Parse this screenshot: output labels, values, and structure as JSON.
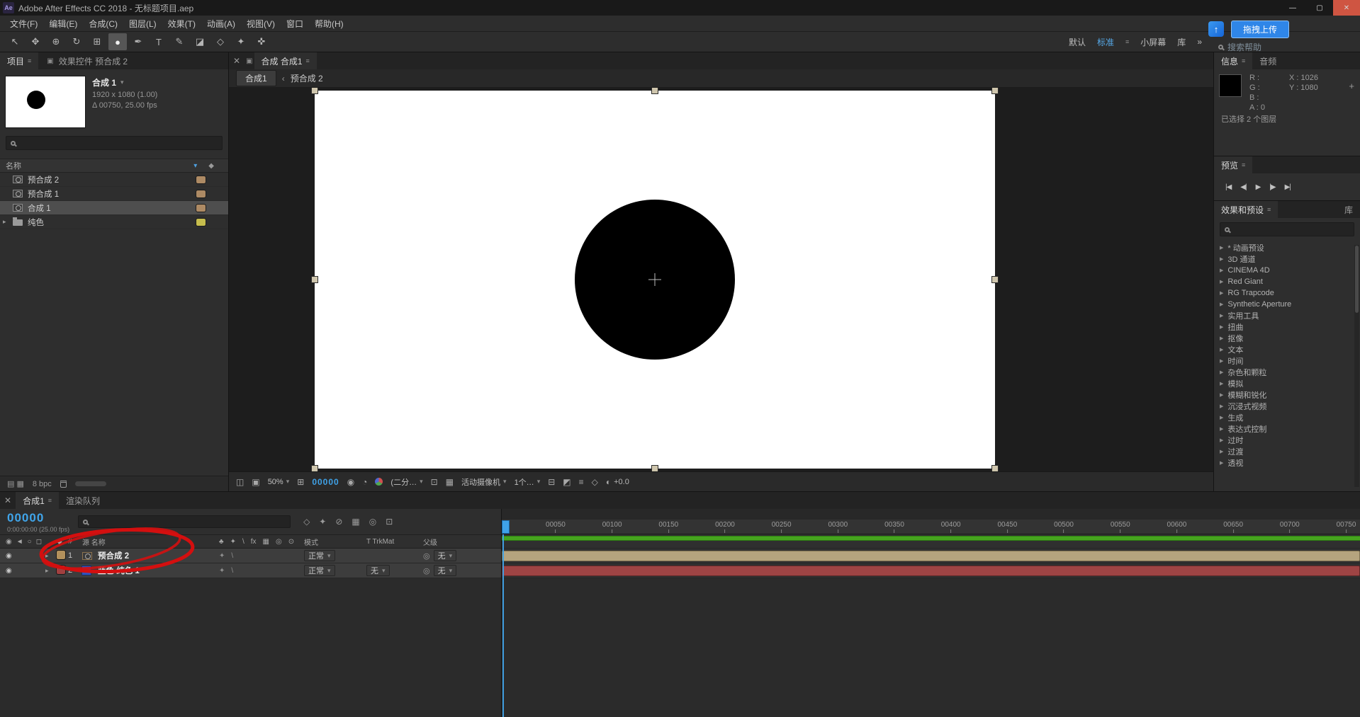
{
  "colors": {
    "accent_blue": "#3fa2e8",
    "annotation_red": "#d40f0f",
    "green_bar": "#46a41e"
  },
  "icons": {
    "menu": "≡",
    "dropdown": "▾",
    "expander": "▸",
    "close": "✕",
    "chevron_left": "‹",
    "diamond": "◆",
    "eye": "◉",
    "pickwhip": "◎",
    "tri_right": "▶",
    "plus": "+",
    "panel": "▣"
  },
  "title_bar": {
    "app_icon": "Ae",
    "title": "Adobe After Effects CC 2018 - 无标题项目.aep",
    "minimize": "—",
    "maximize": "▢",
    "close": "✕"
  },
  "menu_bar": [
    "文件(F)",
    "编辑(E)",
    "合成(C)",
    "图层(L)",
    "效果(T)",
    "动画(A)",
    "视图(V)",
    "窗口",
    "帮助(H)"
  ],
  "toolbar": {
    "tools": [
      {
        "name": "selection-tool",
        "glyph": "↖",
        "active": false
      },
      {
        "name": "hand-tool",
        "glyph": "✥",
        "active": false
      },
      {
        "name": "zoom-tool",
        "glyph": "⊕",
        "active": false
      },
      {
        "name": "orbit-camera-tool",
        "glyph": "↻",
        "active": false
      },
      {
        "name": "pan-behind-tool",
        "glyph": "⊞",
        "active": false
      },
      {
        "name": "shape-tool",
        "glyph": "●",
        "active": true
      },
      {
        "name": "pen-tool",
        "glyph": "✒",
        "active": false
      },
      {
        "name": "text-tool",
        "glyph": "T",
        "active": false
      },
      {
        "name": "brush-tool",
        "glyph": "✎",
        "active": false
      },
      {
        "name": "clone-stamp-tool",
        "glyph": "◪",
        "active": false
      },
      {
        "name": "eraser-tool",
        "glyph": "◇",
        "active": false
      },
      {
        "name": "roto-brush-tool",
        "glyph": "✦",
        "active": false
      },
      {
        "name": "puppet-pin-tool",
        "glyph": "✜",
        "active": false
      }
    ],
    "workspaces": [
      {
        "name": "workspace-default",
        "label": "默认",
        "active": false
      },
      {
        "name": "workspace-standard",
        "label": "标准",
        "active": true
      },
      {
        "name": "workspace-small-screen",
        "label": "小屏幕",
        "active": false
      },
      {
        "name": "workspace-library",
        "label": "库",
        "active": false
      },
      {
        "name": "workspace-overflow",
        "label": "»",
        "active": false
      }
    ]
  },
  "overlay": {
    "icon_glyph": "↑",
    "upload_button": "拖拽上传",
    "search_help": "搜索帮助"
  },
  "project_panel": {
    "tab_project": "项目",
    "tab_effect_controls": "效果控件 预合成 2",
    "comp_name": "合成 1",
    "comp_dims": "1920 x 1080 (1.00)",
    "comp_duration": "Δ 00750, 25.00 fps",
    "header_name": "名称",
    "items": [
      {
        "name": "预合成 2",
        "type": "comp",
        "label_color": "#ad8a64",
        "selected": false
      },
      {
        "name": "预合成 1",
        "type": "comp",
        "label_color": "#ad8a64",
        "selected": false
      },
      {
        "name": "合成 1",
        "type": "comp",
        "label_color": "#ad8a64",
        "selected": true
      },
      {
        "name": "纯色",
        "type": "folder",
        "label_color": "#c6bd4d",
        "selected": false
      }
    ],
    "footer_icons": [
      {
        "name": "project-settings-icon",
        "glyph": "▤"
      },
      {
        "name": "new-folder-icon",
        "glyph": "▦"
      }
    ],
    "bit_depth": "8 bpc"
  },
  "comp_panel": {
    "tab_label": "合成 合成1",
    "nav_comp": "合成1",
    "nav_current": "预合成 2",
    "controls": [
      {
        "kind": "icon",
        "name": "snapshot-icon",
        "glyph": "◫"
      },
      {
        "kind": "icon",
        "name": "show-snapshot-icon",
        "glyph": "▣"
      },
      {
        "kind": "dropdown",
        "name": "magnification-select",
        "label": "50%"
      },
      {
        "kind": "icon",
        "name": "grid-guides-icon",
        "glyph": "⊞"
      },
      {
        "kind": "blue",
        "name": "viewer-timecode",
        "label": "00000"
      },
      {
        "kind": "icon",
        "name": "camera-icon",
        "glyph": "◉"
      },
      {
        "kind": "icon",
        "name": "mask-visibility-icon",
        "glyph": "◔"
      },
      {
        "kind": "rgb",
        "name": "channel-icon"
      },
      {
        "kind": "dropdown",
        "name": "resolution-select",
        "label": "(二分…"
      },
      {
        "kind": "icon",
        "name": "roi-icon",
        "glyph": "⊡"
      },
      {
        "kind": "icon",
        "name": "transparency-grid-icon",
        "glyph": "▦"
      },
      {
        "kind": "dropdown",
        "name": "camera-view-select",
        "label": "活动摄像机"
      },
      {
        "kind": "dropdown",
        "name": "view-layout-select",
        "label": "1个…"
      },
      {
        "kind": "icon",
        "name": "pixel-aspect-icon",
        "glyph": "⊟"
      },
      {
        "kind": "icon",
        "name": "fast-preview-icon",
        "glyph": "◩"
      },
      {
        "kind": "icon",
        "name": "timeline-button-icon",
        "glyph": "≡"
      },
      {
        "kind": "icon",
        "name": "flowchart-button-icon",
        "glyph": "◇"
      },
      {
        "kind": "exposure",
        "name": "exposure-control",
        "glyph": "◐",
        "label": "+0.0"
      }
    ]
  },
  "info_panel": {
    "tab_info": "信息",
    "tab_audio": "音频",
    "rgba_lines": [
      "R :",
      "G :",
      "B :",
      "A :  0"
    ],
    "x": "X : 1026",
    "y": "Y : 1080",
    "plus": "+",
    "selection": "已选择 2 个图层"
  },
  "preview_panel": {
    "title": "预览",
    "buttons": [
      {
        "name": "first-frame-button",
        "glyph": "|◀"
      },
      {
        "name": "prev-frame-button",
        "glyph": "◀|"
      },
      {
        "name": "play-button",
        "glyph": "▶"
      },
      {
        "name": "next-frame-button",
        "glyph": "|▶"
      },
      {
        "name": "last-frame-button",
        "glyph": "▶|"
      }
    ]
  },
  "effects_panel": {
    "title": "效果和预设",
    "library_tab": "库",
    "categories": [
      "* 动画预设",
      "3D 通道",
      "CINEMA 4D",
      "Red Giant",
      "RG Trapcode",
      "Synthetic Aperture",
      "实用工具",
      "扭曲",
      "抠像",
      "文本",
      "时间",
      "杂色和颗粒",
      "模拟",
      "模糊和锐化",
      "沉浸式视频",
      "生成",
      "表达式控制",
      "过时",
      "过渡",
      "透视"
    ]
  },
  "timeline": {
    "tab_comp": "合成1",
    "tab_render_queue": "渲染队列",
    "timecode": "00000",
    "timecode_detail": "0:00:00:00 (25.00 fps)",
    "col_number": "#",
    "col_source_name": "源 名称",
    "col_mode": "模式",
    "col_trkmat": "T TrkMat",
    "col_parent": "父级",
    "toggle_icons": [
      {
        "name": "composition-mini-flowchart-icon",
        "glyph": "◇"
      },
      {
        "name": "draft-3d-icon",
        "glyph": "✦"
      },
      {
        "name": "hide-shy-layers-icon",
        "glyph": "⊘"
      },
      {
        "name": "frame-blending-icon",
        "glyph": "▦"
      },
      {
        "name": "motion-blur-icon",
        "glyph": "◎"
      },
      {
        "name": "graph-editor-icon",
        "glyph": "⊡"
      }
    ],
    "av_header_icons": [
      {
        "name": "video-column-icon",
        "glyph": "◉"
      },
      {
        "name": "audio-column-icon",
        "glyph": "◄"
      },
      {
        "name": "solo-column-icon",
        "glyph": "○"
      },
      {
        "name": "lock-column-icon",
        "glyph": "◻"
      }
    ],
    "switch_header_icons": [
      {
        "name": "shy-column-icon",
        "glyph": "♣"
      },
      {
        "name": "collapse-column-icon",
        "glyph": "✦"
      },
      {
        "name": "quality-column-icon",
        "glyph": "\\"
      },
      {
        "name": "fx-column-icon",
        "glyph": "fx"
      },
      {
        "name": "frame-blend-column-icon",
        "glyph": "▦"
      },
      {
        "name": "motion-blur-column-icon",
        "glyph": "◎"
      },
      {
        "name": "threed-column-icon",
        "glyph": "⊙"
      }
    ],
    "row_switch_glyphs": [
      "✦",
      "\\"
    ],
    "layers": [
      {
        "num": "1",
        "name": "预合成 2",
        "type": "comp",
        "mode": "正常",
        "trkmat": "",
        "parent": "无",
        "selected": true,
        "chip": "#b3915c",
        "icon_color": "#8d7350",
        "bar": "#b5a47e",
        "bar_border": "#7e7050"
      },
      {
        "num": "2",
        "name": "蓝色 纯色 1",
        "type": "solid",
        "mode": "正常",
        "trkmat": "无",
        "parent": "无",
        "selected": true,
        "chip": "#a24040",
        "icon_color": "#2e55c0",
        "bar": "#9e4444",
        "bar_border": "#5e2828"
      }
    ],
    "ruler_ticks": [
      "00050",
      "00100",
      "00150",
      "00200",
      "00250",
      "00300",
      "00350",
      "00400",
      "00450",
      "00500",
      "00550",
      "00600",
      "00650",
      "00700",
      "00750"
    ]
  }
}
